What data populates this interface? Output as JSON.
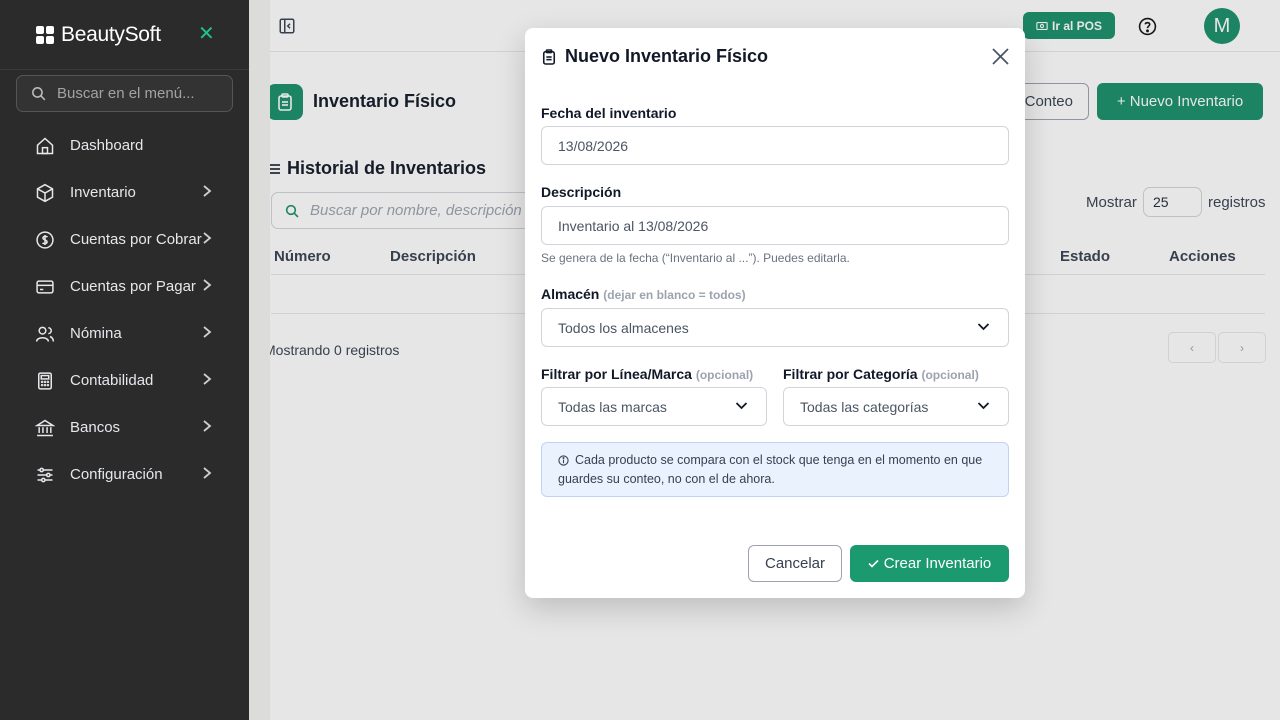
{
  "app": {
    "name": "BeautySoft"
  },
  "sidebar": {
    "search_placeholder": "Buscar en el menú...",
    "items": [
      {
        "label": "Dashboard",
        "icon": "home-icon",
        "has_submenu": false
      },
      {
        "label": "Inventario",
        "icon": "box-icon",
        "has_submenu": true
      },
      {
        "label": "Cuentas por Cobrar",
        "icon": "dollar-icon",
        "has_submenu": true
      },
      {
        "label": "Cuentas por Pagar",
        "icon": "card-icon",
        "has_submenu": true
      },
      {
        "label": "Nómina",
        "icon": "users-icon",
        "has_submenu": true
      },
      {
        "label": "Contabilidad",
        "icon": "calculator-icon",
        "has_submenu": true
      },
      {
        "label": "Bancos",
        "icon": "bank-icon",
        "has_submenu": true
      },
      {
        "label": "Configuración",
        "icon": "sliders-icon",
        "has_submenu": true
      }
    ]
  },
  "topbar": {
    "pos_label": "Ir al POS",
    "avatar_initial": "M"
  },
  "page": {
    "title": "Inventario Físico",
    "conteo_label": "Conteo",
    "new_label": "+ Nuevo Inventario"
  },
  "history": {
    "title": "Historial de Inventarios",
    "search_placeholder": "Buscar por nombre, descripción",
    "show_label": "Mostrar",
    "page_size": "25",
    "records_label": "registros",
    "columns": [
      "Número",
      "Descripción",
      "Estado",
      "Acciones"
    ],
    "footer": "Mostrando 0 registros",
    "prev": "‹",
    "next": "›"
  },
  "modal": {
    "title": "Nuevo Inventario Físico",
    "date_label": "Fecha del inventario",
    "date_value": "13/08/2026",
    "desc_label": "Descripción",
    "desc_value": "Inventario al 13/08/2026",
    "desc_hint": "Se genera de la fecha (“Inventario al ...”). Puedes editarla.",
    "warehouse_label": "Almacén",
    "warehouse_note": "(dejar en blanco = todos)",
    "warehouse_value": "Todos los almacenes",
    "brand_label": "Filtrar por Línea/Marca",
    "brand_note": "(opcional)",
    "brand_value": "Todas las marcas",
    "category_label": "Filtrar por Categoría",
    "category_note": "(opcional)",
    "category_value": "Todas las categorías",
    "info_text": "Cada producto se compara con el stock que tenga en el momento en que guardes su conteo, no con el de ahora.",
    "cancel_label": "Cancelar",
    "create_label": "Crear Inventario"
  },
  "colors": {
    "brand": "#178f69",
    "sidebar": "#2b2b2b",
    "info_bg": "#eaf2fd"
  }
}
